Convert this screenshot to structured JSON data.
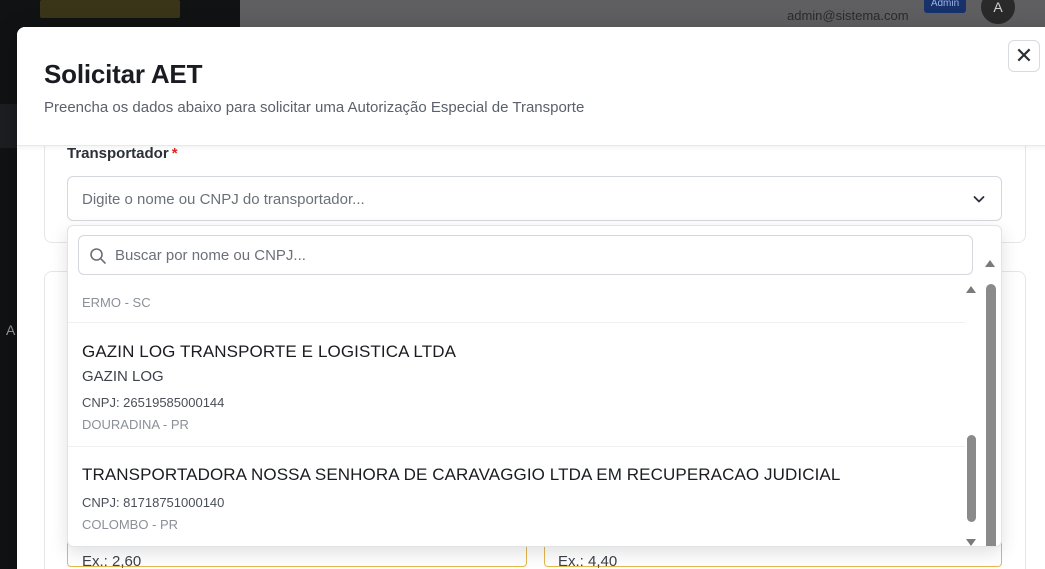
{
  "background": {
    "email": "admin@sistema.com",
    "badge": "Admin",
    "avatar_initial": "A",
    "edge_letter": "A"
  },
  "modal": {
    "title": "Solicitar AET",
    "description": "Preencha os dados abaixo para solicitar uma Autorização Especial de Transporte",
    "close_glyph": "✕"
  },
  "transportador": {
    "label": "Transportador",
    "required_mark": "*",
    "placeholder": "Digite o nome ou CNPJ do transportador..."
  },
  "dropdown": {
    "search_placeholder": "Buscar por nome ou CNPJ...",
    "partial_top_location": "ERMO - SC",
    "options": [
      {
        "name": "GAZIN LOG TRANSPORTE E LOGISTICA LTDA",
        "fantasy": "GAZIN LOG",
        "cnpj": "CNPJ: 26519585000144",
        "location": "DOURADINA - PR"
      },
      {
        "name": "TRANSPORTADORA NOSSA SENHORA DE CARAVAGGIO LTDA EM RECUPERACAO JUDICIAL",
        "cnpj": "CNPJ: 81718751000140",
        "location": "COLOMBO - PR"
      }
    ]
  },
  "hints": {
    "left": "Ex.: 2,60",
    "right": "Ex.: 4,40"
  },
  "colors": {
    "required": "#dc2626",
    "warning_border": "#e5b84f"
  }
}
